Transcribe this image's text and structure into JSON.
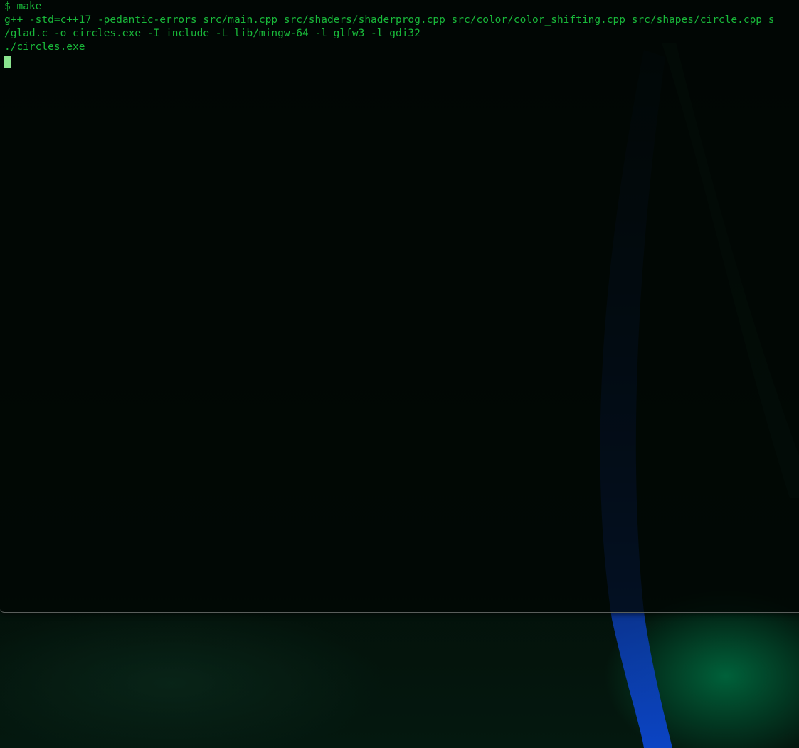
{
  "terminal": {
    "text_color": "#19b83a",
    "cursor_color": "#8be38f",
    "background": "#000000",
    "lines": [
      "$ make",
      "g++ -std=c++17 -pedantic-errors src/main.cpp src/shaders/shaderprog.cpp src/color/color_shifting.cpp src/shapes/circle.cpp s",
      "/glad.c -o circles.exe -I include -L lib/mingw-64 -l glfw3 -l gdi32",
      "./circles.exe"
    ]
  },
  "wallpaper": {
    "colors": [
      "#03120c",
      "#0b3fb0",
      "#00522e"
    ]
  }
}
